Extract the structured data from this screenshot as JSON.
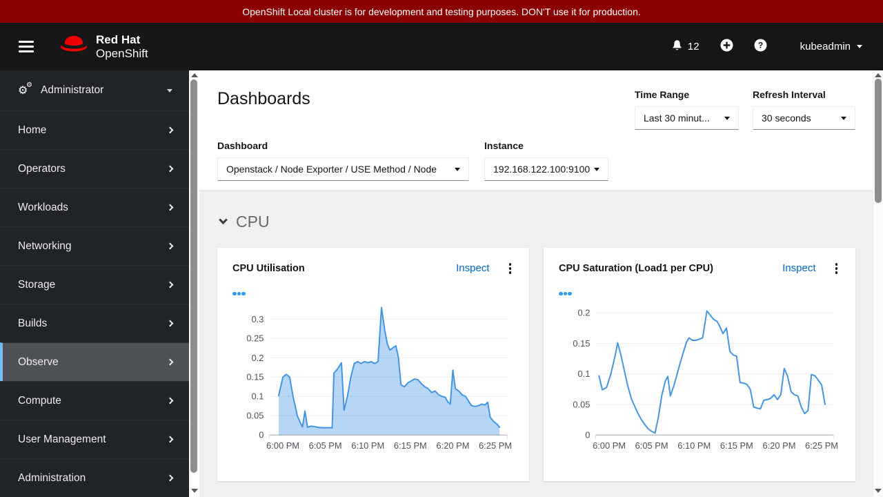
{
  "banner": {
    "text": "OpenShift Local cluster is for development and testing purposes. DON'T use it for production."
  },
  "masthead": {
    "brand_line1": "Red Hat",
    "brand_line2": "OpenShift",
    "notification_count": "12",
    "username": "kubeadmin"
  },
  "icons": {
    "gears_glyph": "⚙",
    "help_glyph": "?"
  },
  "sidebar": {
    "perspective": {
      "label": "Administrator"
    },
    "active_item": "Observe",
    "items": [
      {
        "label": "Home"
      },
      {
        "label": "Operators"
      },
      {
        "label": "Workloads"
      },
      {
        "label": "Networking"
      },
      {
        "label": "Storage"
      },
      {
        "label": "Builds"
      },
      {
        "label": "Observe"
      },
      {
        "label": "Compute"
      },
      {
        "label": "User Management"
      },
      {
        "label": "Administration"
      }
    ]
  },
  "page": {
    "title": "Dashboards",
    "controls": {
      "time_range_label": "Time Range",
      "time_range_value": "Last 30 minut...",
      "refresh_label": "Refresh Interval",
      "refresh_value": "30 seconds",
      "dashboard_label": "Dashboard",
      "dashboard_value": "Openstack / Node Exporter / USE Method / Node",
      "instance_label": "Instance",
      "instance_value": "192.168.122.100:9100"
    }
  },
  "cpu_section": {
    "title": "CPU",
    "cards": [
      {
        "title": "CPU Utilisation",
        "inspect_label": "Inspect"
      },
      {
        "title": "CPU Saturation (Load1 per CPU)",
        "inspect_label": "Inspect"
      }
    ]
  },
  "chart_data": [
    {
      "type": "area",
      "title": "CPU Utilisation",
      "color": "#4394e5",
      "fill": "rgba(67,148,229,0.38)",
      "ylim": [
        0,
        0.34
      ],
      "yticks": [
        0,
        0.05,
        0.1,
        0.15,
        0.2,
        0.25,
        0.3
      ],
      "xmin": -1.6,
      "xmax": 26.4,
      "xticks": [
        {
          "x": 0,
          "label": "6:00 PM"
        },
        {
          "x": 5,
          "label": "6:05 PM"
        },
        {
          "x": 10,
          "label": "6:10 PM"
        },
        {
          "x": 15,
          "label": "6:15 PM"
        },
        {
          "x": 20,
          "label": "6:20 PM"
        },
        {
          "x": 25,
          "label": "6:25 PM"
        }
      ],
      "grid": true,
      "legend_position": "top-left",
      "values": [
        [
          -0.5,
          0.102
        ],
        [
          -0.2,
          0.13
        ],
        [
          0,
          0.15
        ],
        [
          0.4,
          0.157
        ],
        [
          0.8,
          0.15
        ],
        [
          1.2,
          0.1
        ],
        [
          1.7,
          0.05
        ],
        [
          2.1,
          0.03
        ],
        [
          2.3,
          0.021
        ],
        [
          2.6,
          0.062
        ],
        [
          2.9,
          0.02
        ],
        [
          3.3,
          0.023
        ],
        [
          3.7,
          0.022
        ],
        [
          4.1,
          0.02
        ],
        [
          4.6,
          0.019
        ],
        [
          5.0,
          0.019
        ],
        [
          5.4,
          0.019
        ],
        [
          5.8,
          0.019
        ],
        [
          6.0,
          0.16
        ],
        [
          6.4,
          0.17
        ],
        [
          6.9,
          0.187
        ],
        [
          7.2,
          0.064
        ],
        [
          7.6,
          0.1
        ],
        [
          8.0,
          0.15
        ],
        [
          8.4,
          0.185
        ],
        [
          8.8,
          0.19
        ],
        [
          9.2,
          0.185
        ],
        [
          9.6,
          0.19
        ],
        [
          10.0,
          0.187
        ],
        [
          10.4,
          0.19
        ],
        [
          10.8,
          0.185
        ],
        [
          11.2,
          0.19
        ],
        [
          11.6,
          0.33
        ],
        [
          12.0,
          0.27
        ],
        [
          12.3,
          0.235
        ],
        [
          12.6,
          0.22
        ],
        [
          12.9,
          0.225
        ],
        [
          13.3,
          0.231
        ],
        [
          13.6,
          0.2
        ],
        [
          13.9,
          0.13
        ],
        [
          14.3,
          0.125
        ],
        [
          14.7,
          0.135
        ],
        [
          15.1,
          0.14
        ],
        [
          15.5,
          0.145
        ],
        [
          15.9,
          0.143
        ],
        [
          16.3,
          0.133
        ],
        [
          16.7,
          0.125
        ],
        [
          17.1,
          0.12
        ],
        [
          17.5,
          0.11
        ],
        [
          17.9,
          0.114
        ],
        [
          18.3,
          0.105
        ],
        [
          18.7,
          0.1
        ],
        [
          19.1,
          0.098
        ],
        [
          19.4,
          0.086
        ],
        [
          19.7,
          0.08
        ],
        [
          20.0,
          0.168
        ],
        [
          20.3,
          0.12
        ],
        [
          20.7,
          0.114
        ],
        [
          21.1,
          0.104
        ],
        [
          21.5,
          0.1
        ],
        [
          21.9,
          0.086
        ],
        [
          22.2,
          0.076
        ],
        [
          22.6,
          0.074
        ],
        [
          23.0,
          0.076
        ],
        [
          23.4,
          0.08
        ],
        [
          23.8,
          0.078
        ],
        [
          24.1,
          0.085
        ],
        [
          24.4,
          0.046
        ],
        [
          24.8,
          0.035
        ],
        [
          25.2,
          0.028
        ],
        [
          25.5,
          0.02
        ]
      ]
    },
    {
      "type": "line",
      "title": "CPU Saturation (Load1 per CPU)",
      "color": "#4394e5",
      "fill": "none",
      "ylim": [
        0,
        0.215
      ],
      "yticks": [
        0,
        0.05,
        0.1,
        0.15,
        0.2
      ],
      "xmin": -1.6,
      "xmax": 26.4,
      "xticks": [
        {
          "x": 0,
          "label": "6:00 PM"
        },
        {
          "x": 5,
          "label": "6:05 PM"
        },
        {
          "x": 10,
          "label": "6:10 PM"
        },
        {
          "x": 15,
          "label": "6:15 PM"
        },
        {
          "x": 20,
          "label": "6:20 PM"
        },
        {
          "x": 25,
          "label": "6:25 PM"
        }
      ],
      "grid": true,
      "legend_position": "top-left",
      "values": [
        [
          -1.2,
          0.097
        ],
        [
          -0.8,
          0.074
        ],
        [
          -0.3,
          0.078
        ],
        [
          0.2,
          0.1
        ],
        [
          0.7,
          0.13
        ],
        [
          1.0,
          0.151
        ],
        [
          1.4,
          0.13
        ],
        [
          1.8,
          0.104
        ],
        [
          2.2,
          0.08
        ],
        [
          2.6,
          0.06
        ],
        [
          3.0,
          0.047
        ],
        [
          3.4,
          0.035
        ],
        [
          3.8,
          0.025
        ],
        [
          4.2,
          0.017
        ],
        [
          4.6,
          0.01
        ],
        [
          5.0,
          0.006
        ],
        [
          5.4,
          0.003
        ],
        [
          5.8,
          0.03
        ],
        [
          6.2,
          0.065
        ],
        [
          6.6,
          0.088
        ],
        [
          6.9,
          0.096
        ],
        [
          7.2,
          0.064
        ],
        [
          7.6,
          0.08
        ],
        [
          8.0,
          0.1
        ],
        [
          8.4,
          0.12
        ],
        [
          8.8,
          0.139
        ],
        [
          9.1,
          0.152
        ],
        [
          9.4,
          0.159
        ],
        [
          9.8,
          0.155
        ],
        [
          10.2,
          0.155
        ],
        [
          10.6,
          0.157
        ],
        [
          11.0,
          0.159
        ],
        [
          11.5,
          0.203
        ],
        [
          11.9,
          0.196
        ],
        [
          12.3,
          0.189
        ],
        [
          12.7,
          0.186
        ],
        [
          13.0,
          0.178
        ],
        [
          13.4,
          0.166
        ],
        [
          13.8,
          0.175
        ],
        [
          14.2,
          0.137
        ],
        [
          14.6,
          0.131
        ],
        [
          15.0,
          0.129
        ],
        [
          15.4,
          0.086
        ],
        [
          15.8,
          0.085
        ],
        [
          16.2,
          0.083
        ],
        [
          16.6,
          0.075
        ],
        [
          17.0,
          0.046
        ],
        [
          17.4,
          0.044
        ],
        [
          17.8,
          0.043
        ],
        [
          18.2,
          0.057
        ],
        [
          18.6,
          0.058
        ],
        [
          19.0,
          0.06
        ],
        [
          19.4,
          0.066
        ],
        [
          19.8,
          0.058
        ],
        [
          20.2,
          0.066
        ],
        [
          20.6,
          0.109
        ],
        [
          21.0,
          0.096
        ],
        [
          21.4,
          0.071
        ],
        [
          21.8,
          0.066
        ],
        [
          22.2,
          0.064
        ],
        [
          22.6,
          0.046
        ],
        [
          23.0,
          0.035
        ],
        [
          23.4,
          0.04
        ],
        [
          23.8,
          0.099
        ],
        [
          24.2,
          0.097
        ],
        [
          24.6,
          0.09
        ],
        [
          25.0,
          0.082
        ],
        [
          25.4,
          0.05
        ]
      ]
    }
  ],
  "colors": {
    "banner_bg": "#8b0101",
    "masthead_bg": "#161616",
    "sidebar_bg": "#212427",
    "sidebar_active_bg": "#4f5255",
    "sidebar_active_border": "#73bcf7",
    "body_bg": "#f0f0f0",
    "link_blue": "#0066cc",
    "chart_line": "#4394e5",
    "legend_dot": "#2b9af3"
  }
}
